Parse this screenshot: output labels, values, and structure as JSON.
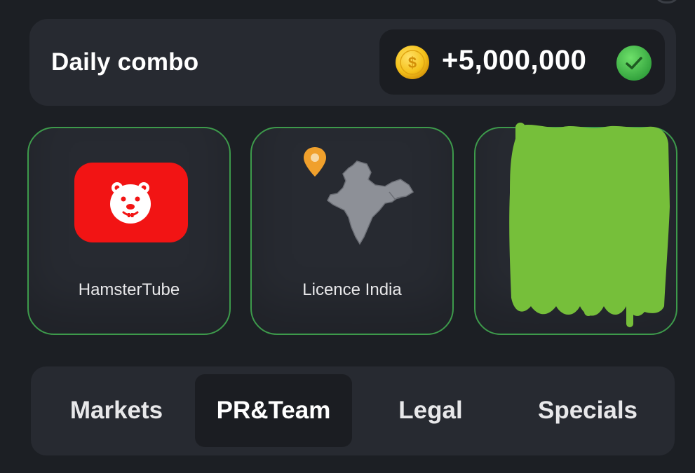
{
  "daily_combo": {
    "title": "Daily combo",
    "reward": "+5,000,000",
    "status": "completed",
    "icons": {
      "coin": "coin-icon",
      "check": "check-icon"
    }
  },
  "cards": [
    {
      "label": "HamsterTube",
      "icon": "hamstertube-icon"
    },
    {
      "label": "Licence India",
      "icon": "india-map-icon"
    },
    {
      "label": "",
      "icon": "redacted-scribble",
      "redacted": true
    }
  ],
  "tabs": [
    {
      "label": "Markets",
      "selected": false
    },
    {
      "label": "PR&Team",
      "selected": true
    },
    {
      "label": "Legal",
      "selected": false
    },
    {
      "label": "Specials",
      "selected": false
    }
  ],
  "colors": {
    "background": "#1c1f24",
    "panel": "#272a31",
    "card_border": "#3d9a4b",
    "selected_tab": "#1b1d22",
    "youtube_red": "#f21414",
    "coin_gold": "#f5c21b",
    "check_green": "#4fc255",
    "redaction_green": "#76bf3a"
  }
}
